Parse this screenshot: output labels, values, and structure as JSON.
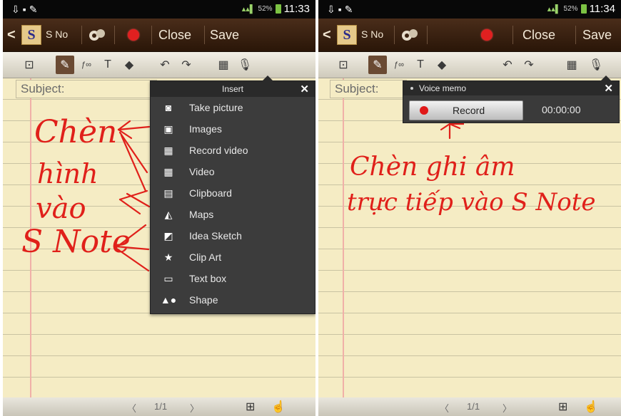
{
  "left": {
    "status": {
      "time": "11:33",
      "battery": "52%"
    },
    "appbar": {
      "title": "S No",
      "close": "Close",
      "save": "Save"
    },
    "subject_placeholder": "Subject:",
    "insert_menu": {
      "title": "Insert",
      "items": [
        {
          "label": "Take picture",
          "icon": "camera-icon"
        },
        {
          "label": "Images",
          "icon": "image-icon"
        },
        {
          "label": "Record video",
          "icon": "video-camera-icon"
        },
        {
          "label": "Video",
          "icon": "film-icon"
        },
        {
          "label": "Clipboard",
          "icon": "clipboard-icon"
        },
        {
          "label": "Maps",
          "icon": "map-icon"
        },
        {
          "label": "Idea Sketch",
          "icon": "sketch-icon"
        },
        {
          "label": "Clip Art",
          "icon": "clip-art-icon"
        },
        {
          "label": "Text box",
          "icon": "text-box-icon"
        },
        {
          "label": "Shape",
          "icon": "shape-icon"
        }
      ]
    },
    "annotation": [
      "Chèn",
      "hình",
      "vào",
      "S Note"
    ],
    "page_indicator": "1/1"
  },
  "right": {
    "status": {
      "time": "11:34",
      "battery": "52%"
    },
    "appbar": {
      "title": "S No",
      "close": "Close",
      "save": "Save"
    },
    "subject_placeholder": "Subject:",
    "voice_memo": {
      "title": "Voice memo",
      "record": "Record",
      "timer": "00:00:00"
    },
    "annotation": [
      "Chèn ghi âm",
      "trực tiếp vào S Note"
    ],
    "page_indicator": "1/1"
  },
  "colors": {
    "accent_red": "#e0201a",
    "appbar_brown": "#3a2211",
    "paper": "#f5ecc4"
  }
}
